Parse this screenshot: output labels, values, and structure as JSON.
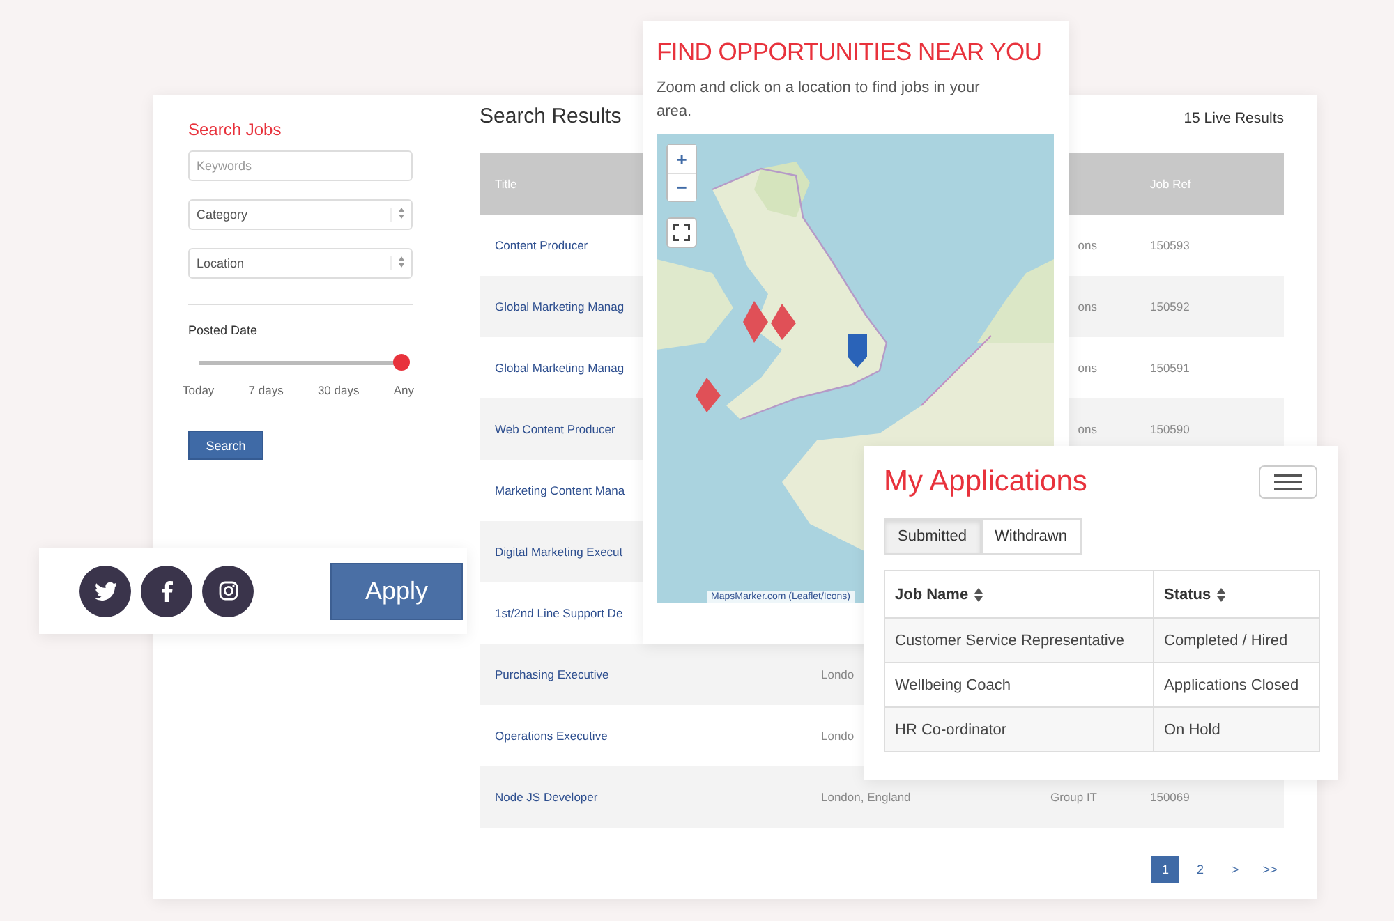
{
  "search_panel": {
    "title": "Search Jobs",
    "keywords": {
      "placeholder": "Keywords"
    },
    "selects": [
      {
        "label": "Category"
      },
      {
        "label": "Location"
      }
    ],
    "posted_date": {
      "label": "Posted Date",
      "level": 1,
      "ticks": [
        "Today",
        "7 days",
        "30 days",
        "Any"
      ]
    },
    "search_button": "Search"
  },
  "results": {
    "title": "Search Results",
    "count": "15 Live Results",
    "columns": [
      {
        "kind": "title",
        "label": "Title"
      },
      {
        "kind": "location"
      },
      {
        "kind": "category"
      },
      {
        "kind": "ref",
        "label": "Job Ref"
      }
    ],
    "rows": [
      {
        "title": "Content Producer",
        "category": "ons",
        "ref": "150593"
      },
      {
        "title": "Global Marketing Manag",
        "category": "ons",
        "ref": "150592"
      },
      {
        "title": "Global Marketing Manag",
        "category": "ons",
        "ref": "150591"
      },
      {
        "title": "Web Content Producer",
        "category": "ons",
        "ref": "150590"
      },
      {
        "title": "Marketing Content Mana"
      },
      {
        "title": "Digital Marketing Execut"
      },
      {
        "title": "1st/2nd Line Support De"
      },
      {
        "title": "Purchasing Executive",
        "location": "Londo"
      },
      {
        "title": "Operations Executive",
        "location": "Londo"
      },
      {
        "title": "Node JS Developer",
        "location": "London, England",
        "category": "Group IT",
        "ref": "150069"
      }
    ],
    "pagination": [
      {
        "label": "1",
        "selected": true
      },
      {
        "label": "2",
        "selected": false
      },
      {
        "label": ">",
        "selected": false
      },
      {
        "label": ">>",
        "selected": false
      }
    ]
  },
  "map_card": {
    "title": "FIND OPPORTUNITIES NEAR YOU",
    "description": "Zoom and click on a location to find jobs in your area.",
    "map": {
      "kind": "picture",
      "zoom_in": "+",
      "zoom_out": "−",
      "attribution": "MapsMarker.com (Leaflet/Icons)"
    }
  },
  "share_card": {
    "social": [
      {
        "kind": "twitter"
      },
      {
        "kind": "facebook"
      },
      {
        "kind": "instagram"
      }
    ],
    "apply_button": "Apply"
  },
  "applications": {
    "title": "My Applications",
    "tabs": [
      {
        "label": "Submitted",
        "selected": true
      },
      {
        "label": "Withdrawn",
        "selected": false
      }
    ],
    "columns": [
      "Job Name",
      "Status"
    ],
    "rows": [
      [
        "Customer Service Representative",
        "Completed / Hired"
      ],
      [
        "Wellbeing Coach",
        "Applications Closed"
      ],
      [
        "HR Co-ordinator",
        "On Hold"
      ]
    ]
  }
}
